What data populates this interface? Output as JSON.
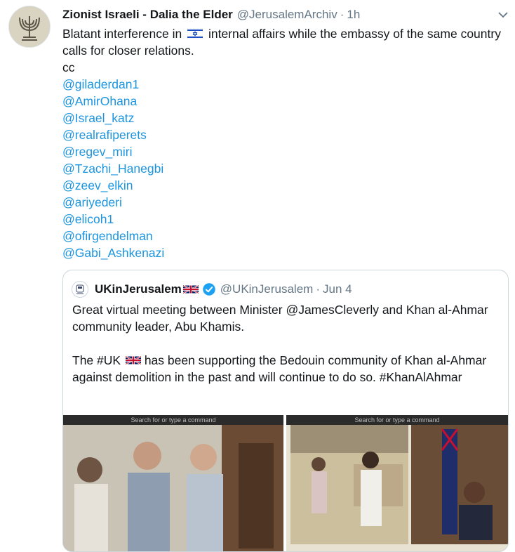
{
  "tweet": {
    "author_name": "Zionist Israeli - Dalia the Elder",
    "author_handle": "@JerusalemArchiv",
    "separator": "·",
    "time": "1h",
    "text_before_flag": "Blatant interference in",
    "text_after_flag": "internal affairs while the embassy of the same country calls for closer relations.",
    "cc": "cc",
    "mentions": [
      "@giladerdan1",
      "@AmirOhana",
      "@Israel_katz",
      "@realrafiperets",
      "@regev_miri",
      "@Tzachi_Hanegbi",
      "@zeev_elkin",
      "@ariyederi",
      "@elicoh1",
      "@ofirgendelman",
      "@Gabi_Ashkenazi"
    ],
    "flag_icon": "israel-flag-icon"
  },
  "quoted": {
    "author_name": "UKinJerusalem",
    "author_handle": "@UKinJerusalem",
    "separator": "·",
    "date": "Jun 4",
    "paragraph1": "Great virtual meeting between Minister @JamesCleverly and Khan al-Ahmar community leader, Abu Khamis.",
    "paragraph2_part1": "The #UK",
    "paragraph2_part2": "has been supporting the Bedouin community of Khan al-Ahmar against demolition in the past and will continue to do so. #KhanAlAhmar",
    "media_search_text_1": "Search for or type a command",
    "media_search_text_2": "Search for or type a command",
    "flag_icon": "uk-flag-icon",
    "verified_icon": "verified-badge-icon"
  },
  "colors": {
    "link": "#1b95e0",
    "secondary_text": "#657786",
    "border": "#ccd6dd"
  }
}
